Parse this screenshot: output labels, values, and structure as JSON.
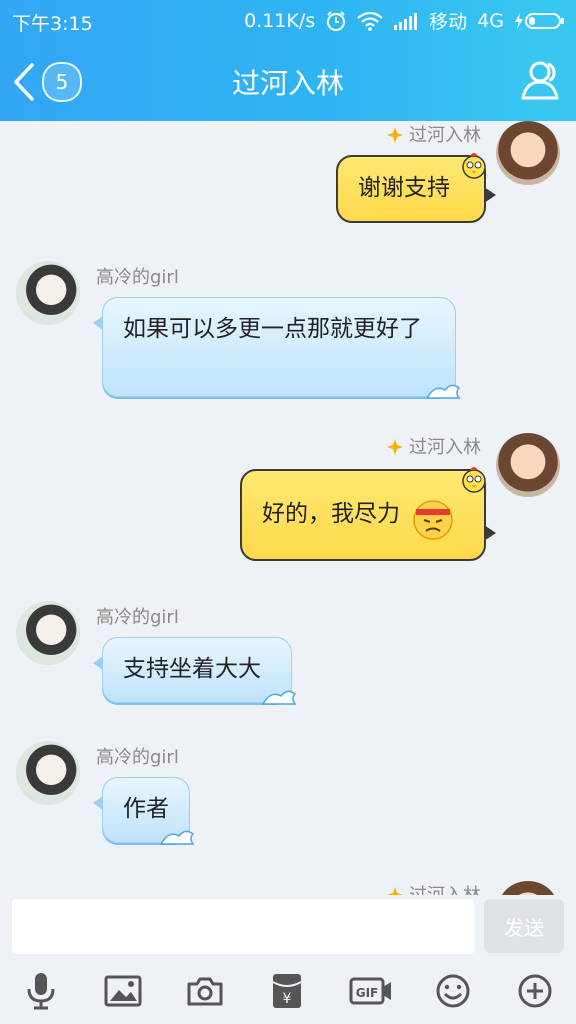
{
  "status": {
    "time": "下午3:15",
    "speed": "0.11K/s",
    "carrier": "移动",
    "network": "4G",
    "icons": [
      "alarm-icon",
      "wifi-icon",
      "signal-icon",
      "battery-charging-icon"
    ]
  },
  "nav": {
    "title": "过河入林",
    "unread_count": "5",
    "back_icon": "chevron-left-icon",
    "profile_icon": "user-profile-icon"
  },
  "messages": [
    {
      "side": "out",
      "sender": "过河入林",
      "text": "谢谢支持"
    },
    {
      "side": "in",
      "sender": "高冷的girl",
      "text": "如果可以多更一点那就更好了"
    },
    {
      "side": "out",
      "sender": "过河入林",
      "text": "好的，我尽力"
    },
    {
      "side": "in",
      "sender": "高冷的girl",
      "text": "支持坐着大大"
    },
    {
      "side": "in",
      "sender": "高冷的girl",
      "text": "作者"
    },
    {
      "side": "out",
      "sender": "过河入林",
      "text": ""
    }
  ],
  "input": {
    "placeholder": "",
    "value": "",
    "send_label": "发送"
  },
  "toolbar": {
    "icons": [
      "microphone-icon",
      "image-icon",
      "camera-icon",
      "red-packet-icon",
      "gif-icon",
      "emoji-icon",
      "plus-icon"
    ]
  },
  "colors": {
    "accent": "#2fb4f3",
    "bubble_in": "#c7e6fb",
    "bubble_out": "#ffdd55",
    "background": "#eef1f6"
  }
}
